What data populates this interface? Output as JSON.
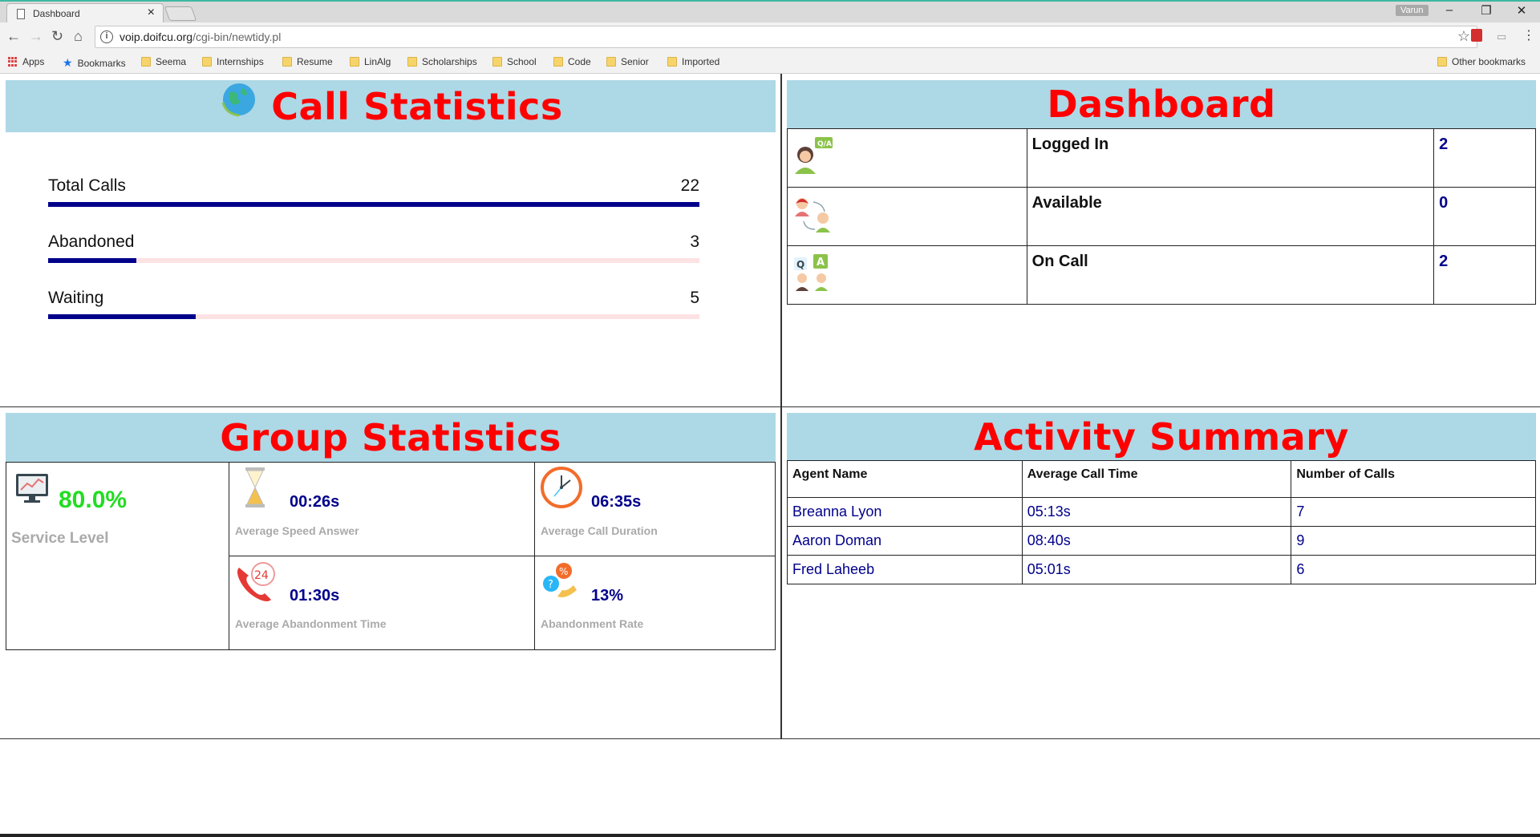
{
  "browser": {
    "tab_title": "Dashboard",
    "tab_close": "×",
    "profile_name": "Varun",
    "window_controls": [
      "–",
      "❐",
      "✕"
    ],
    "url_host": "voip.doifcu.org",
    "url_path": "/cgi-bin/newtidy.pl",
    "bookmarks": [
      "Apps",
      "Bookmarks",
      "Seema",
      "Internships",
      "Resume",
      "LinAlg",
      "Scholarships",
      "School",
      "Code",
      "Senior",
      "Imported"
    ],
    "other_bookmarks": "Other bookmarks"
  },
  "call_statistics": {
    "title": "Call Statistics",
    "stats": [
      {
        "label": "Total Calls",
        "value": "22",
        "fraction": 1.0
      },
      {
        "label": "Abandoned",
        "value": "3",
        "fraction": 0.136
      },
      {
        "label": "Waiting",
        "value": "5",
        "fraction": 0.227
      }
    ]
  },
  "dashboard": {
    "title": "Dashboard",
    "rows": [
      {
        "icon": "agent-qa-icon",
        "label": "Logged In",
        "value": "2"
      },
      {
        "icon": "agents-transfer-icon",
        "label": "Available",
        "value": "0"
      },
      {
        "icon": "agents-on-call-icon",
        "label": "On Call",
        "value": "2"
      }
    ]
  },
  "group_statistics": {
    "title": "Group Statistics",
    "service_level": {
      "value": "80.0%",
      "label": "Service Level",
      "icon": "monitor-chart-icon"
    },
    "metrics": [
      {
        "value": "00:26s",
        "label": "Average Speed Answer",
        "icon": "hourglass-icon"
      },
      {
        "value": "06:35s",
        "label": "Average Call Duration",
        "icon": "clock-icon"
      },
      {
        "value": "01:30s",
        "label": "Average Abandonment Time",
        "icon": "phone-24-icon"
      },
      {
        "value": "13%",
        "label": "Abandonment Rate",
        "icon": "phone-percent-icon"
      }
    ]
  },
  "activity_summary": {
    "title": "Activity Summary",
    "columns": [
      "Agent Name",
      "Average Call Time",
      "Number of Calls"
    ],
    "rows": [
      [
        "Breanna Lyon",
        "05:13s",
        "7"
      ],
      [
        "Aaron Doman",
        "08:40s",
        "9"
      ],
      [
        "Fred Laheeb",
        "05:01s",
        "6"
      ]
    ]
  }
}
